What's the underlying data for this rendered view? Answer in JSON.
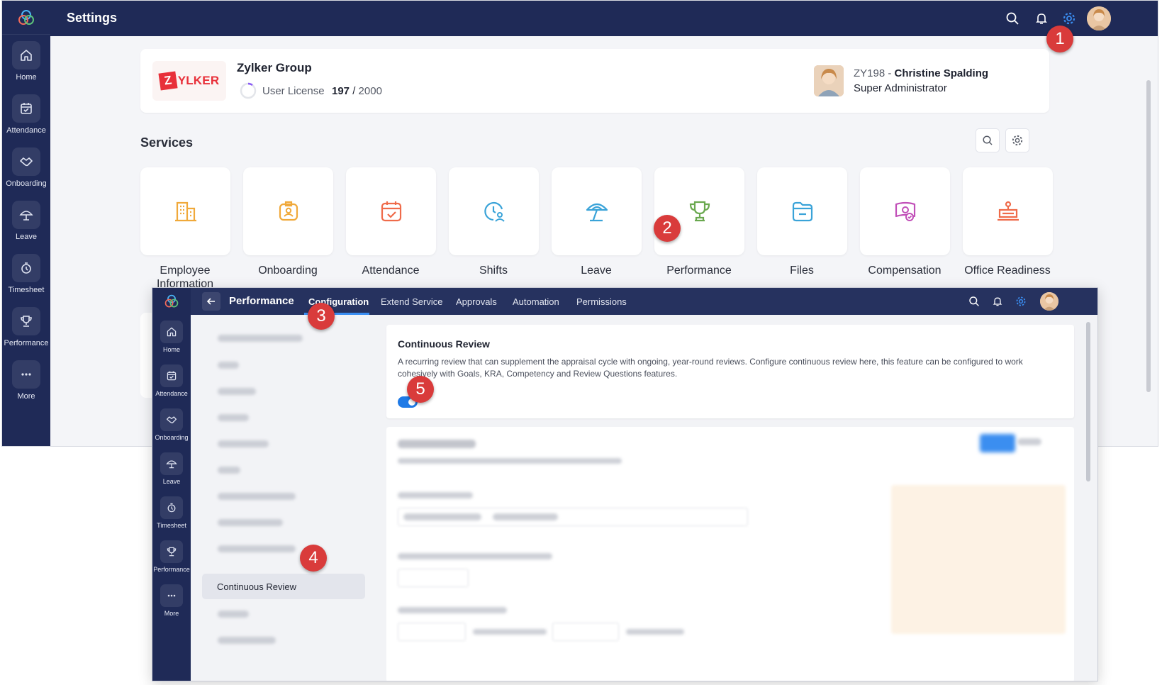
{
  "colors": {
    "navy": "#1f2a57",
    "accent": "#1f7ae6",
    "badge": "#d93b3b",
    "logo_red": "#e8303a"
  },
  "settings_window": {
    "title": "Settings",
    "sidebar": [
      {
        "label": "Home",
        "icon": "home-icon"
      },
      {
        "label": "Attendance",
        "icon": "calendar-check-icon"
      },
      {
        "label": "Onboarding",
        "icon": "handshake-icon"
      },
      {
        "label": "Leave",
        "icon": "umbrella-icon"
      },
      {
        "label": "Timesheet",
        "icon": "timer-icon"
      },
      {
        "label": "Performance",
        "icon": "trophy-icon"
      },
      {
        "label": "More",
        "icon": "more-icon"
      }
    ],
    "org": {
      "logo_letter": "Z",
      "logo_text": "YLKER",
      "name": "Zylker Group",
      "license_label": "User License",
      "license_used": "197",
      "license_total": "2000",
      "user_id": "ZY198 -",
      "user_name": "Christine Spalding",
      "user_role": "Super Administrator"
    },
    "services_title": "Services",
    "services": [
      {
        "label": "Employee Information",
        "icon": "building-icon"
      },
      {
        "label": "Onboarding",
        "icon": "id-badge-icon"
      },
      {
        "label": "Attendance",
        "icon": "calendar-check-icon"
      },
      {
        "label": "Shifts",
        "icon": "clock-user-icon"
      },
      {
        "label": "Leave",
        "icon": "umbrella-icon"
      },
      {
        "label": "Performance",
        "icon": "trophy-icon"
      },
      {
        "label": "Files",
        "icon": "folder-icon"
      },
      {
        "label": "Compensation",
        "icon": "money-icon"
      },
      {
        "label": "Office Readiness",
        "icon": "desk-icon"
      }
    ]
  },
  "performance_window": {
    "title": "Performance",
    "tabs": [
      "Configuration",
      "Extend Service",
      "Approvals",
      "Automation",
      "Permissions"
    ],
    "active_tab": "Configuration",
    "sidebar": [
      "Home",
      "Attendance",
      "Onboarding",
      "Leave",
      "Timesheet",
      "Performance",
      "More"
    ],
    "active_menu_item": "Continuous Review",
    "section_title": "Continuous Review",
    "section_description": "A recurring review that can supplement the appraisal cycle with ongoing, year-round reviews. Configure continuous review here, this feature can be configured to work cohesively with Goals, KRA, Competency and Review Questions features.",
    "toggle_on": true
  },
  "callouts": [
    "1",
    "2",
    "3",
    "4",
    "5"
  ]
}
